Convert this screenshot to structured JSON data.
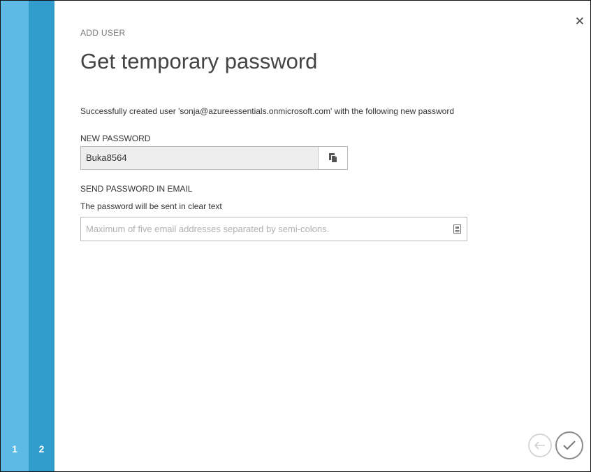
{
  "wizard": {
    "steps": [
      {
        "number": "1"
      },
      {
        "number": "2"
      }
    ],
    "close_icon": "close-icon"
  },
  "dialog": {
    "eyebrow": "ADD USER",
    "title": "Get temporary password",
    "success_message": "Successfully created user 'sonja@azureessentials.onmicrosoft.com' with the following new password"
  },
  "new_password": {
    "label": "NEW PASSWORD",
    "value": "Buka8564",
    "copy_icon": "copy-icon"
  },
  "send_email": {
    "label": "SEND PASSWORD IN EMAIL",
    "hint": "The password will be sent in clear text",
    "placeholder": "Maximum of five email addresses separated by semi-colons.",
    "value": "",
    "contact_icon": "contact-card-icon"
  },
  "footer": {
    "back_icon": "arrow-left-icon",
    "complete_icon": "checkmark-icon"
  },
  "colors": {
    "step1": "#5bbbe5",
    "step2": "#2f9ccc"
  }
}
